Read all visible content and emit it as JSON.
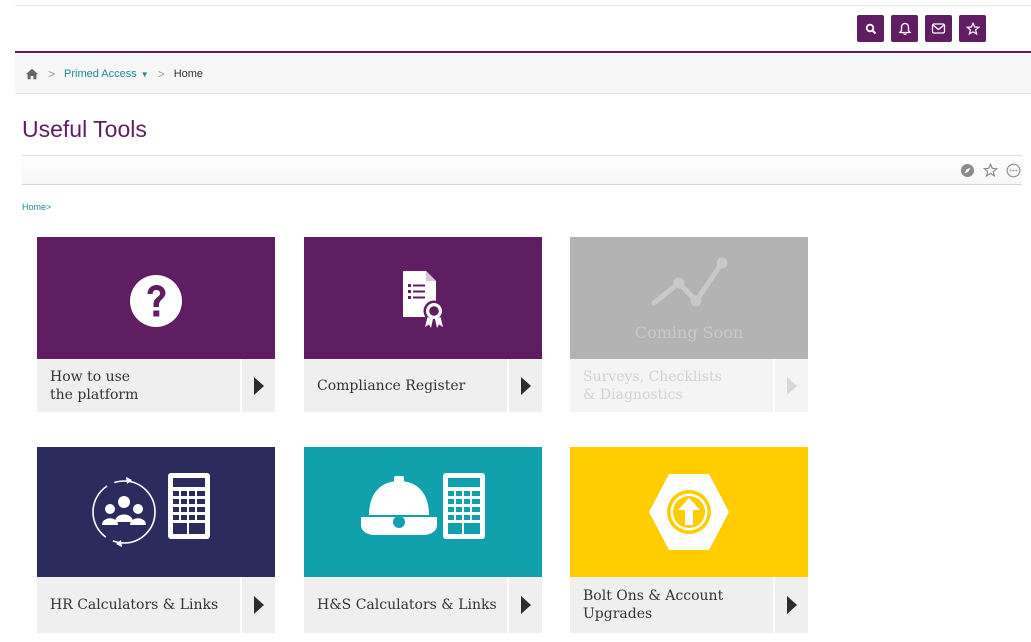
{
  "header": {
    "icons": [
      "search-icon",
      "bell-icon",
      "mail-icon",
      "star-icon"
    ],
    "accent_color": "#5f1d62"
  },
  "breadcrumb": {
    "home_icon": "home-icon",
    "section": "Primed Access",
    "current": "Home"
  },
  "page": {
    "title": "Useful Tools",
    "toolbar_icons": [
      "compass-icon",
      "star-outline-icon",
      "more-icon"
    ],
    "home_link": "Home>"
  },
  "tiles": [
    {
      "label_line1": "How to use",
      "label_line2": "the platform",
      "color": "#5f1d62",
      "icon": "question-icon"
    },
    {
      "label": "Compliance Register",
      "color": "#5f1d62",
      "icon": "certificate-document-icon"
    },
    {
      "label_line1": "Surveys, Checklists",
      "label_line2": "& Diagnostics",
      "color": "#b3b3b3",
      "icon": "line-chart-icon",
      "overlay": "Coming Soon"
    },
    {
      "label": "HR Calculators & Links",
      "color": "#2c2b5e",
      "icon": "people-calculator-icon"
    },
    {
      "label": "H&S Calculators & Links",
      "color": "#10a1ac",
      "icon": "hardhat-calculator-icon"
    },
    {
      "label_line1": "Bolt Ons & Account",
      "label_line2": "Upgrades",
      "color": "#ffcc00",
      "icon": "bolt-upgrade-icon"
    }
  ]
}
